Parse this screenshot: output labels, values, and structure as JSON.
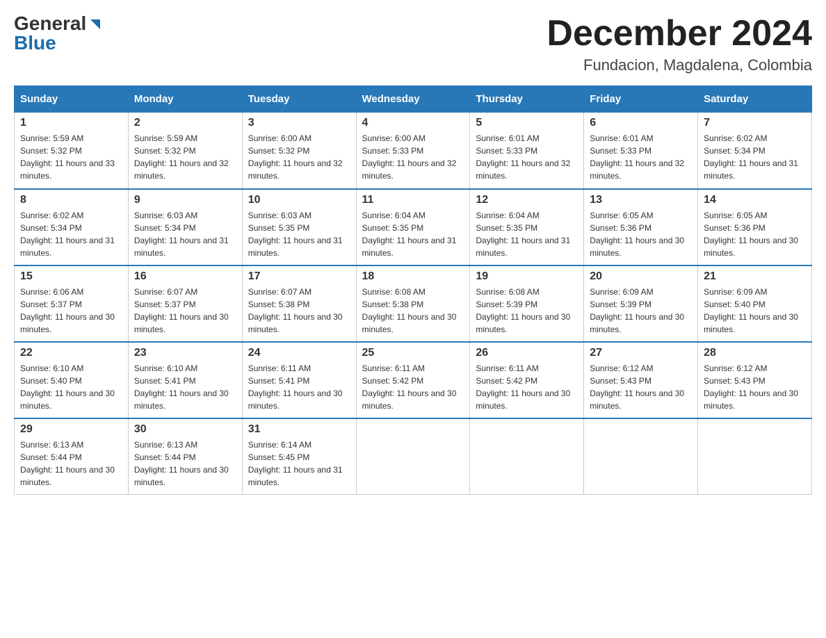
{
  "header": {
    "logo_general": "General",
    "logo_blue": "Blue",
    "month_title": "December 2024",
    "location": "Fundacion, Magdalena, Colombia"
  },
  "days_of_week": [
    "Sunday",
    "Monday",
    "Tuesday",
    "Wednesday",
    "Thursday",
    "Friday",
    "Saturday"
  ],
  "weeks": [
    [
      {
        "day": "1",
        "sunrise": "5:59 AM",
        "sunset": "5:32 PM",
        "daylight": "11 hours and 33 minutes."
      },
      {
        "day": "2",
        "sunrise": "5:59 AM",
        "sunset": "5:32 PM",
        "daylight": "11 hours and 32 minutes."
      },
      {
        "day": "3",
        "sunrise": "6:00 AM",
        "sunset": "5:32 PM",
        "daylight": "11 hours and 32 minutes."
      },
      {
        "day": "4",
        "sunrise": "6:00 AM",
        "sunset": "5:33 PM",
        "daylight": "11 hours and 32 minutes."
      },
      {
        "day": "5",
        "sunrise": "6:01 AM",
        "sunset": "5:33 PM",
        "daylight": "11 hours and 32 minutes."
      },
      {
        "day": "6",
        "sunrise": "6:01 AM",
        "sunset": "5:33 PM",
        "daylight": "11 hours and 32 minutes."
      },
      {
        "day": "7",
        "sunrise": "6:02 AM",
        "sunset": "5:34 PM",
        "daylight": "11 hours and 31 minutes."
      }
    ],
    [
      {
        "day": "8",
        "sunrise": "6:02 AM",
        "sunset": "5:34 PM",
        "daylight": "11 hours and 31 minutes."
      },
      {
        "day": "9",
        "sunrise": "6:03 AM",
        "sunset": "5:34 PM",
        "daylight": "11 hours and 31 minutes."
      },
      {
        "day": "10",
        "sunrise": "6:03 AM",
        "sunset": "5:35 PM",
        "daylight": "11 hours and 31 minutes."
      },
      {
        "day": "11",
        "sunrise": "6:04 AM",
        "sunset": "5:35 PM",
        "daylight": "11 hours and 31 minutes."
      },
      {
        "day": "12",
        "sunrise": "6:04 AM",
        "sunset": "5:35 PM",
        "daylight": "11 hours and 31 minutes."
      },
      {
        "day": "13",
        "sunrise": "6:05 AM",
        "sunset": "5:36 PM",
        "daylight": "11 hours and 30 minutes."
      },
      {
        "day": "14",
        "sunrise": "6:05 AM",
        "sunset": "5:36 PM",
        "daylight": "11 hours and 30 minutes."
      }
    ],
    [
      {
        "day": "15",
        "sunrise": "6:06 AM",
        "sunset": "5:37 PM",
        "daylight": "11 hours and 30 minutes."
      },
      {
        "day": "16",
        "sunrise": "6:07 AM",
        "sunset": "5:37 PM",
        "daylight": "11 hours and 30 minutes."
      },
      {
        "day": "17",
        "sunrise": "6:07 AM",
        "sunset": "5:38 PM",
        "daylight": "11 hours and 30 minutes."
      },
      {
        "day": "18",
        "sunrise": "6:08 AM",
        "sunset": "5:38 PM",
        "daylight": "11 hours and 30 minutes."
      },
      {
        "day": "19",
        "sunrise": "6:08 AM",
        "sunset": "5:39 PM",
        "daylight": "11 hours and 30 minutes."
      },
      {
        "day": "20",
        "sunrise": "6:09 AM",
        "sunset": "5:39 PM",
        "daylight": "11 hours and 30 minutes."
      },
      {
        "day": "21",
        "sunrise": "6:09 AM",
        "sunset": "5:40 PM",
        "daylight": "11 hours and 30 minutes."
      }
    ],
    [
      {
        "day": "22",
        "sunrise": "6:10 AM",
        "sunset": "5:40 PM",
        "daylight": "11 hours and 30 minutes."
      },
      {
        "day": "23",
        "sunrise": "6:10 AM",
        "sunset": "5:41 PM",
        "daylight": "11 hours and 30 minutes."
      },
      {
        "day": "24",
        "sunrise": "6:11 AM",
        "sunset": "5:41 PM",
        "daylight": "11 hours and 30 minutes."
      },
      {
        "day": "25",
        "sunrise": "6:11 AM",
        "sunset": "5:42 PM",
        "daylight": "11 hours and 30 minutes."
      },
      {
        "day": "26",
        "sunrise": "6:11 AM",
        "sunset": "5:42 PM",
        "daylight": "11 hours and 30 minutes."
      },
      {
        "day": "27",
        "sunrise": "6:12 AM",
        "sunset": "5:43 PM",
        "daylight": "11 hours and 30 minutes."
      },
      {
        "day": "28",
        "sunrise": "6:12 AM",
        "sunset": "5:43 PM",
        "daylight": "11 hours and 30 minutes."
      }
    ],
    [
      {
        "day": "29",
        "sunrise": "6:13 AM",
        "sunset": "5:44 PM",
        "daylight": "11 hours and 30 minutes."
      },
      {
        "day": "30",
        "sunrise": "6:13 AM",
        "sunset": "5:44 PM",
        "daylight": "11 hours and 30 minutes."
      },
      {
        "day": "31",
        "sunrise": "6:14 AM",
        "sunset": "5:45 PM",
        "daylight": "11 hours and 31 minutes."
      },
      null,
      null,
      null,
      null
    ]
  ],
  "labels": {
    "sunrise": "Sunrise:",
    "sunset": "Sunset:",
    "daylight": "Daylight:"
  }
}
